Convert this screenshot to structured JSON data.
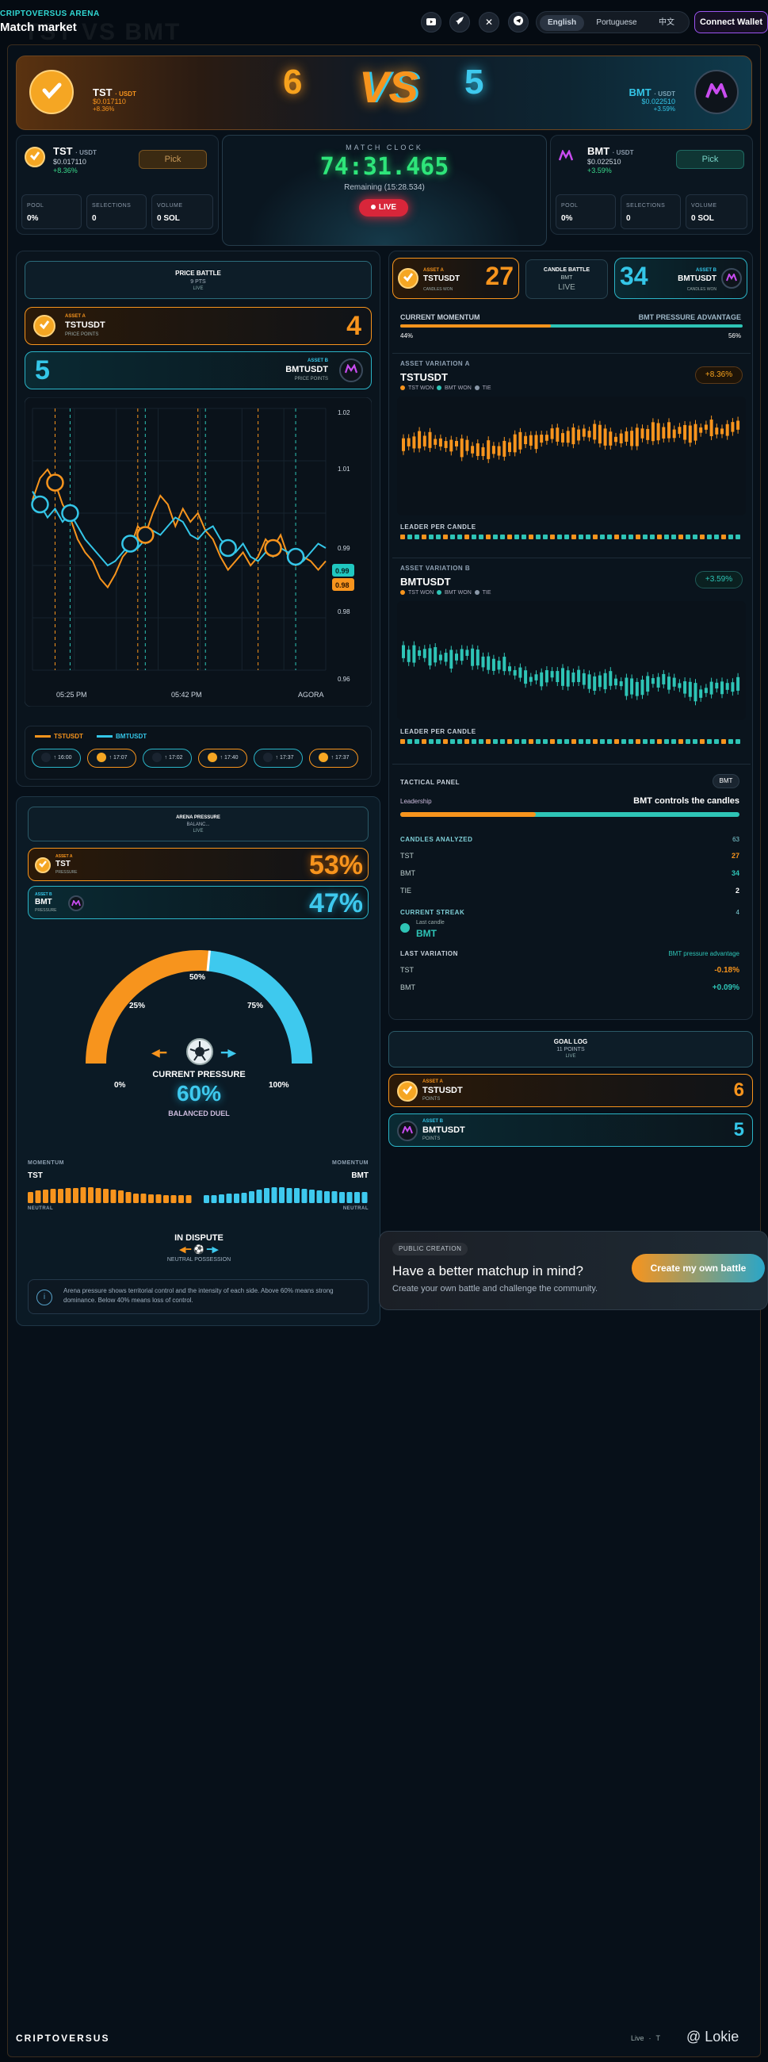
{
  "topbar": {
    "brand_small": "CRIPTOVERSUS ARENA",
    "title": "Match market",
    "ghost_title": "TST VS BMT",
    "languages": [
      "English",
      "Portuguese",
      "中文"
    ],
    "active_language": "English",
    "wallet_label": "Connect Wallet"
  },
  "header": {
    "left": {
      "name": "TST",
      "pair": "· USDT",
      "price": "$0.017110",
      "change": "+8.36%"
    },
    "right": {
      "name": "BMT",
      "pair": "· USDT",
      "price": "$0.022510",
      "change": "+3.59%"
    },
    "score_left": "6",
    "score_right": "5",
    "vs": "VS"
  },
  "tst_panel": {
    "name": "TST",
    "pair": "· USDT",
    "price": "$0.017110",
    "change": "+8.36%",
    "pick_label": "Pick",
    "stats": [
      {
        "label": "POOL",
        "value": "0%"
      },
      {
        "label": "SELECTIONS",
        "value": "0"
      },
      {
        "label": "VOLUME",
        "value": "0 SOL"
      }
    ]
  },
  "bmt_panel": {
    "name": "BMT",
    "pair": "· USDT",
    "price": "$0.022510",
    "change": "+3.59%",
    "pick_label": "Pick",
    "stats": [
      {
        "label": "POOL",
        "value": "0%"
      },
      {
        "label": "SELECTIONS",
        "value": "0"
      },
      {
        "label": "VOLUME",
        "value": "0 SOL"
      }
    ]
  },
  "clock": {
    "label": "MATCH CLOCK",
    "time": "74:31.465",
    "remaining": "Remaining (15:28.534)",
    "live": "LIVE"
  },
  "price_battle": {
    "title": "PRICE BATTLE",
    "points": "9 PTS",
    "live": "LIVE",
    "asset_a": {
      "tag": "ASSET A",
      "name": "TSTUSDT",
      "sub": "PRICE POINTS",
      "score": "4"
    },
    "asset_b": {
      "tag": "ASSET B",
      "name": "BMTUSDT",
      "sub": "PRICE POINTS",
      "score": "5"
    }
  },
  "price_chart": {
    "y_ticks": [
      "1.02",
      "1.01",
      "0.99",
      "0.98",
      "0.96"
    ],
    "x_ticks": [
      "05:25 PM",
      "05:42 PM",
      "AGORA"
    ],
    "legend": [
      "TSTUSDT",
      "BMTUSDT"
    ],
    "marker_end_b": "0.99",
    "marker_end_a": "0.98",
    "events": [
      {
        "asset": "BMT",
        "time": "16:00"
      },
      {
        "asset": "TST",
        "time": "17:07"
      },
      {
        "asset": "BMT",
        "time": "17:02"
      },
      {
        "asset": "TST",
        "time": "17:40"
      },
      {
        "asset": "BMT",
        "time": "17:37"
      },
      {
        "asset": "TST",
        "time": "17:37"
      }
    ]
  },
  "chart_data": [
    {
      "type": "line",
      "title": "",
      "x": [
        0,
        1,
        2,
        3,
        4,
        5,
        6,
        7,
        8,
        9,
        10,
        11,
        12,
        13,
        14,
        15,
        16,
        17,
        18,
        19,
        20,
        21,
        22,
        23,
        24,
        25,
        26,
        27,
        28,
        29,
        30,
        31,
        32,
        33,
        34,
        35,
        36,
        37,
        38,
        39
      ],
      "series": [
        {
          "name": "TSTUSDT",
          "values": [
            0.999,
            1.004,
            1.006,
            1.003,
            0.998,
            0.995,
            0.99,
            0.987,
            0.985,
            0.981,
            0.979,
            0.982,
            0.986,
            0.988,
            0.993,
            0.991,
            0.996,
            1.0,
            0.998,
            0.993,
            0.997,
            0.994,
            0.996,
            0.992,
            0.99,
            0.986,
            0.983,
            0.985,
            0.987,
            0.984,
            0.986,
            0.99,
            0.988,
            0.991,
            0.986,
            0.984,
            0.986,
            0.985,
            0.983,
            0.985
          ]
        },
        {
          "name": "BMTUSDT",
          "values": [
            1.001,
            0.998,
            0.995,
            0.997,
            0.994,
            0.996,
            0.993,
            0.99,
            0.988,
            0.986,
            0.984,
            0.985,
            0.987,
            0.989,
            0.988,
            0.99,
            0.992,
            0.991,
            0.993,
            0.995,
            0.994,
            0.991,
            0.99,
            0.992,
            0.993,
            0.99,
            0.988,
            0.987,
            0.989,
            0.986,
            0.985,
            0.987,
            0.986,
            0.988,
            0.987,
            0.986,
            0.985,
            0.987,
            0.989,
            0.988
          ]
        }
      ],
      "ylim": [
        0.96,
        1.02
      ]
    }
  ],
  "candle_battle": {
    "title": "CANDLE BATTLE",
    "subtitle": "BMT",
    "live": "LIVE",
    "asset_a": {
      "tag": "ASSET A",
      "name": "TSTUSDT",
      "sub": "CANDLES WON",
      "score": "27"
    },
    "asset_b": {
      "tag": "ASSET B",
      "name": "BMTUSDT",
      "sub": "CANDLES WON",
      "score": "34"
    },
    "momentum_label": "CURRENT MOMENTUM",
    "momentum_right": "BMT PRESSURE ADVANTAGE",
    "pct_a": "44%",
    "pct_b": "56%",
    "fraction_a": 0.44
  },
  "variation_a": {
    "label": "ASSET VARIATION A",
    "name": "TSTUSDT",
    "badge": "+8.36%",
    "legend": [
      "TST WON",
      "BMT WON",
      "TIE"
    ],
    "leader_label": "LEADER PER CANDLE"
  },
  "variation_b": {
    "label": "ASSET VARIATION B",
    "name": "BMTUSDT",
    "badge": "+3.59%",
    "legend": [
      "TST WON",
      "BMT WON",
      "TIE"
    ],
    "leader_label": "LEADER PER CANDLE"
  },
  "tactical": {
    "title": "TACTICAL PANEL",
    "badge": "BMT",
    "leadership_label": "Leadership",
    "leadership_value": "BMT controls the candles",
    "fraction_a": 0.4,
    "candles_label": "CANDLES ANALYZED",
    "candles_total": "63",
    "rows": [
      {
        "label": "TST",
        "value": "27"
      },
      {
        "label": "BMT",
        "value": "34"
      },
      {
        "label": "TIE",
        "value": "2"
      }
    ],
    "streak_label": "CURRENT STREAK",
    "streak_value": "4",
    "last_candle_label": "Last candle",
    "last_candle_value": "BMT",
    "last_var_label": "LAST VARIATION",
    "last_var_note": "BMT pressure advantage",
    "last_var": [
      {
        "label": "TST",
        "value": "-0.18%"
      },
      {
        "label": "BMT",
        "value": "+0.09%"
      }
    ]
  },
  "goal_log": {
    "title": "GOAL LOG",
    "points": "11 POINTS",
    "live": "LIVE",
    "asset_a": {
      "tag": "ASSET A",
      "name": "TSTUSDT",
      "sub": "POINTS",
      "score": "6"
    },
    "asset_b": {
      "tag": "ASSET B",
      "name": "BMTUSDT",
      "sub": "POINTS",
      "score": "5"
    }
  },
  "pressure": {
    "title": "ARENA PRESSURE",
    "subtitle": "BALANC...",
    "live": "LIVE",
    "asset_a": {
      "tag": "ASSET A",
      "name": "TST",
      "sub": "PRESSURE",
      "value": "53%"
    },
    "asset_b": {
      "tag": "ASSET B",
      "name": "BMT",
      "sub": "PRESSURE",
      "value": "47%"
    },
    "gauge_ticks": [
      "0%",
      "25%",
      "50%",
      "75%",
      "100%"
    ],
    "gauge_label": "CURRENT PRESSURE",
    "gauge_value": "60%",
    "gauge_sub": "BALANCED DUEL",
    "fraction": 0.53,
    "momentum_left": "MOMENTUM",
    "momentum_right": "MOMENTUM",
    "name_left": "TST",
    "name_right": "BMT",
    "neutral_left": "NEUTRAL",
    "neutral_right": "NEUTRAL",
    "dispute_title": "IN DISPUTE",
    "dispute_sub": "NEUTRAL POSSESSION",
    "info": "Arena pressure shows territorial control and the intensity of each side. Above 60% means strong dominance. Below 40% means loss of control."
  },
  "creation": {
    "tag": "PUBLIC CREATION",
    "title": "Have a better matchup in mind?",
    "text": "Create your own battle and challenge the community.",
    "button": "Create my own battle"
  },
  "footer": {
    "brand": "CRIPTOVERSUS",
    "links": [
      "Live",
      "·",
      "T"
    ],
    "watermark": "@ Lokie"
  },
  "colors": {
    "tst": "#f7941d",
    "bmt": "#34c6e8",
    "live": "#e8283c",
    "clock": "#2ee57a"
  }
}
